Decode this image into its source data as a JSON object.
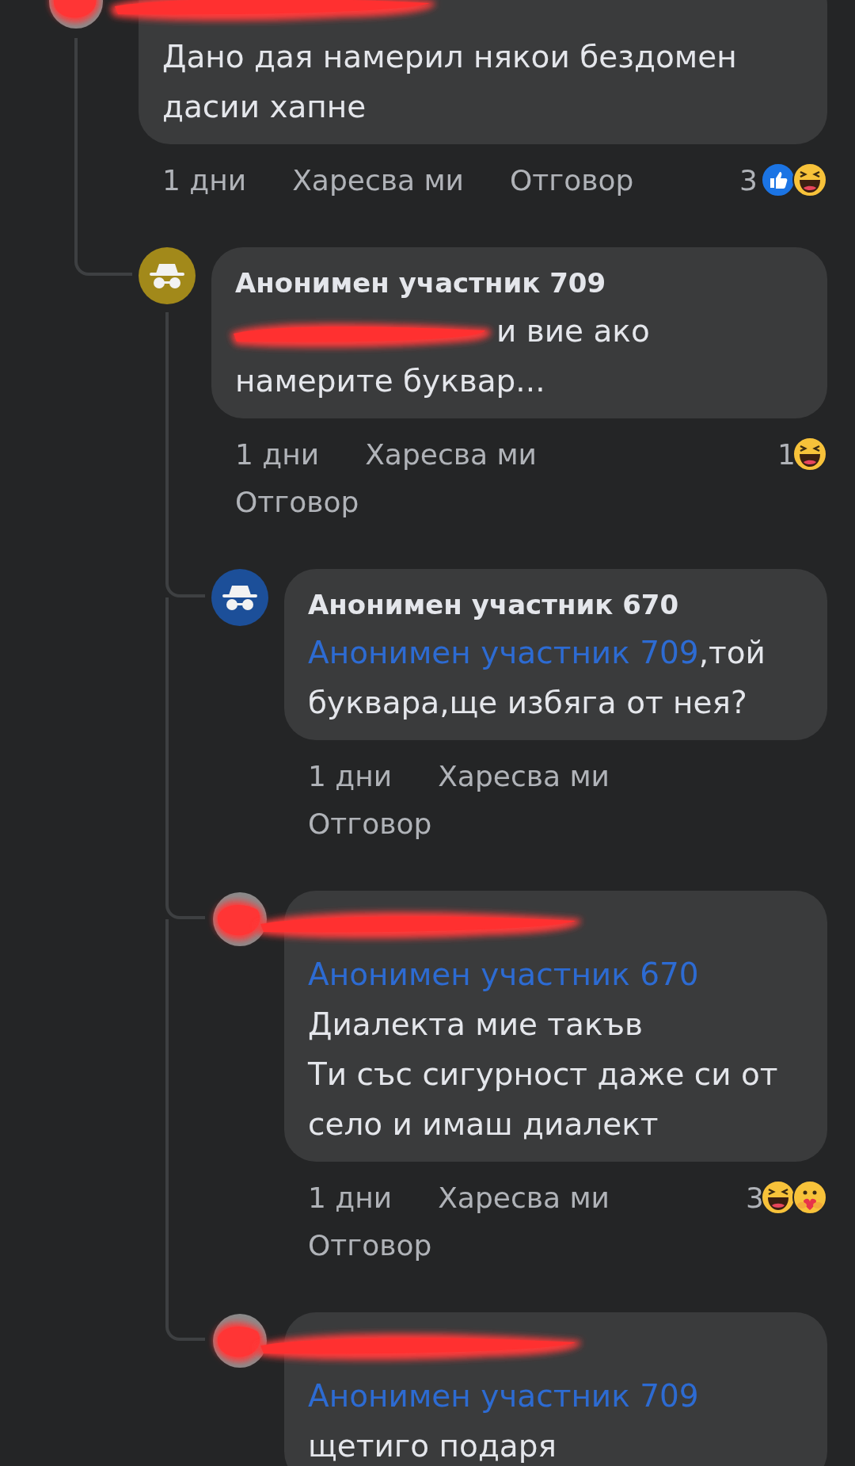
{
  "thread": {
    "author_redacted": true,
    "avatar": {
      "kind": "redacted"
    },
    "lines": [
      [
        {
          "kind": "text",
          "text": "Дано дая намерил някои бездомен"
        }
      ],
      [
        {
          "kind": "text",
          "text": "дасии хапне"
        }
      ]
    ],
    "time": "1 дни",
    "like": "Харесва ми",
    "reply": "Отговор",
    "reaction_count": "3",
    "reactions": [
      {
        "kind": "like"
      },
      {
        "kind": "haha"
      }
    ],
    "replies": [
      {
        "author": "Анонимен участник 709",
        "avatar": {
          "kind": "anonymous",
          "color": "#a2891a"
        },
        "lines": [
          [
            {
              "kind": "redacted"
            },
            {
              "kind": "text",
              "text": "и вие ако"
            }
          ],
          [
            {
              "kind": "text",
              "text": "намерите буквар..."
            }
          ]
        ],
        "time": "1 дни",
        "like": "Харесва ми",
        "reply": "Отговор",
        "reaction_count": "1",
        "reactions": [
          {
            "kind": "haha"
          }
        ],
        "replies": [
          {
            "author": "Анонимен участник 670",
            "avatar": {
              "kind": "anonymous",
              "color": "#1c4f99"
            },
            "lines": [
              [
                {
                  "kind": "mention",
                  "text": "Анонимен участник 709"
                },
                {
                  "kind": "text",
                  "text": ",той"
                }
              ],
              [
                {
                  "kind": "text",
                  "text": "буквара,ще избяга от нея?"
                }
              ]
            ],
            "time": "1 дни",
            "like": "Харесва ми",
            "reply": "Отговор"
          },
          {
            "author_redacted": true,
            "avatar": {
              "kind": "redacted"
            },
            "lines": [
              [
                {
                  "kind": "mention",
                  "text": "Анонимен участник 670"
                }
              ],
              [
                {
                  "kind": "text",
                  "text": "Диалекта мие такъв"
                }
              ],
              [
                {
                  "kind": "text",
                  "text": "Ти със сигурност даже си от"
                }
              ],
              [
                {
                  "kind": "text",
                  "text": "село и имаш диалект"
                }
              ]
            ],
            "time": "1 дни",
            "like": "Харесва ми",
            "reply": "Отговор",
            "reaction_count": "3",
            "reactions": [
              {
                "kind": "haha"
              },
              {
                "kind": "care"
              }
            ]
          },
          {
            "author_redacted": true,
            "avatar": {
              "kind": "redacted"
            },
            "lines": [
              [
                {
                  "kind": "mention",
                  "text": "Анонимен участник 709"
                }
              ],
              [
                {
                  "kind": "text",
                  "text": "щетиго подаря"
                }
              ]
            ]
          }
        ]
      }
    ]
  }
}
